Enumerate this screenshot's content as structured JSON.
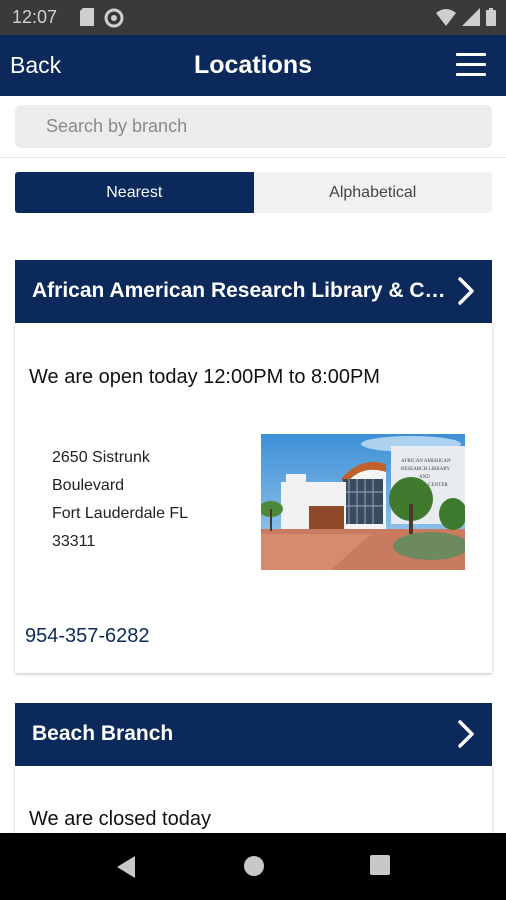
{
  "status_bar": {
    "time": "12:07",
    "icons": [
      "sd-card-icon",
      "sync-icon",
      "wifi-icon",
      "signal-icon",
      "battery-icon"
    ]
  },
  "header": {
    "back_label": "Back",
    "title": "Locations",
    "menu_icon": "hamburger-menu-icon"
  },
  "search": {
    "placeholder": "Search by branch",
    "value": ""
  },
  "sort_tabs": [
    {
      "label": "Nearest",
      "selected": true
    },
    {
      "label": "Alphabetical",
      "selected": false
    }
  ],
  "locations": [
    {
      "name": "African American Research Library & Cultural Center",
      "hours": "We are open today 12:00PM to 8:00PM",
      "address": [
        "2650 Sistrunk",
        "Boulevard",
        "Fort Lauderdale FL",
        "33311"
      ],
      "phone": "954-357-6282",
      "photo_sign": [
        "AFRICAN AMERICAN",
        "RESEARCH LIBRARY",
        "AND",
        "CULTURAL CENTER"
      ]
    },
    {
      "name": "Beach Branch",
      "hours": "We are closed today"
    }
  ],
  "colors": {
    "brand": "#0b2a5b",
    "status_bar": "#3a3a3a",
    "search_bg": "#ececec",
    "inactive_tab": "#f1f1f1"
  },
  "nav_bar": {
    "buttons": [
      "back-triangle-icon",
      "home-circle-icon",
      "recents-square-icon"
    ]
  }
}
